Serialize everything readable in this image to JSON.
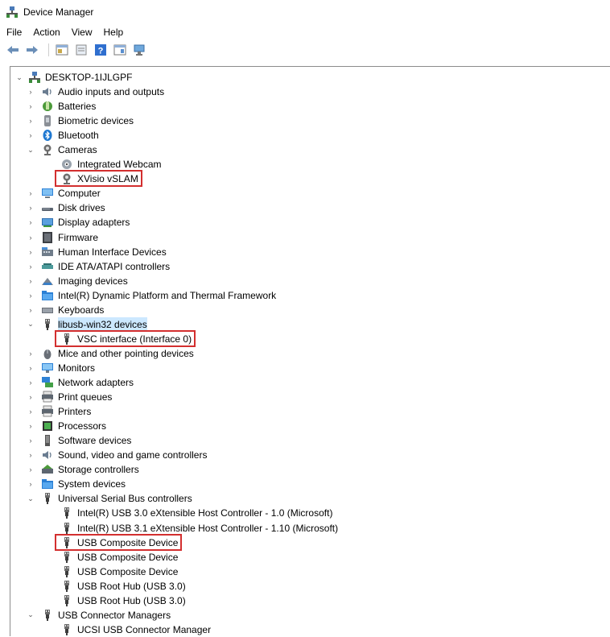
{
  "window": {
    "title": "Device Manager"
  },
  "menu": [
    "File",
    "Action",
    "View",
    "Help"
  ],
  "toolbar": [
    "back-icon",
    "forward-icon",
    "properties-icon",
    "show-hidden-icon",
    "help-icon",
    "update-driver-icon",
    "scan-hardware-icon"
  ],
  "colors": {
    "highlight_box": "#d32f2f",
    "selection": "#cce8ff"
  },
  "tree": {
    "root": "DESKTOP-1IJLGPF",
    "items": [
      {
        "label": "Audio inputs and outputs",
        "icon": "speaker-icon",
        "level": 1,
        "expander": "collapsed"
      },
      {
        "label": "Batteries",
        "icon": "battery-icon",
        "level": 1,
        "expander": "collapsed"
      },
      {
        "label": "Biometric devices",
        "icon": "biometric-icon",
        "level": 1,
        "expander": "collapsed"
      },
      {
        "label": "Bluetooth",
        "icon": "bluetooth-icon",
        "level": 1,
        "expander": "collapsed"
      },
      {
        "label": "Cameras",
        "icon": "camera-icon",
        "level": 1,
        "expander": "expanded"
      },
      {
        "label": "Integrated Webcam",
        "icon": "webcam-icon",
        "level": 2,
        "expander": "none"
      },
      {
        "label": "XVisio vSLAM",
        "icon": "camera-icon",
        "level": 2,
        "expander": "none",
        "highlight": true
      },
      {
        "label": "Computer",
        "icon": "computer-icon",
        "level": 1,
        "expander": "collapsed"
      },
      {
        "label": "Disk drives",
        "icon": "disk-icon",
        "level": 1,
        "expander": "collapsed"
      },
      {
        "label": "Display adapters",
        "icon": "display-adapter-icon",
        "level": 1,
        "expander": "collapsed"
      },
      {
        "label": "Firmware",
        "icon": "firmware-icon",
        "level": 1,
        "expander": "collapsed"
      },
      {
        "label": "Human Interface Devices",
        "icon": "hid-icon",
        "level": 1,
        "expander": "collapsed"
      },
      {
        "label": "IDE ATA/ATAPI controllers",
        "icon": "ide-icon",
        "level": 1,
        "expander": "collapsed"
      },
      {
        "label": "Imaging devices",
        "icon": "imaging-icon",
        "level": 1,
        "expander": "collapsed"
      },
      {
        "label": "Intel(R) Dynamic Platform and Thermal Framework",
        "icon": "folder-icon",
        "level": 1,
        "expander": "collapsed"
      },
      {
        "label": "Keyboards",
        "icon": "keyboard-icon",
        "level": 1,
        "expander": "collapsed"
      },
      {
        "label": "libusb-win32 devices",
        "icon": "usb-plug-icon",
        "level": 1,
        "expander": "expanded",
        "selected": true
      },
      {
        "label": "VSC interface (Interface 0)",
        "icon": "usb-plug-icon",
        "level": 2,
        "expander": "none",
        "highlight": true
      },
      {
        "label": "Mice and other pointing devices",
        "icon": "mouse-icon",
        "level": 1,
        "expander": "collapsed"
      },
      {
        "label": "Monitors",
        "icon": "monitor-icon",
        "level": 1,
        "expander": "collapsed"
      },
      {
        "label": "Network adapters",
        "icon": "network-icon",
        "level": 1,
        "expander": "collapsed"
      },
      {
        "label": "Print queues",
        "icon": "printer-icon",
        "level": 1,
        "expander": "collapsed"
      },
      {
        "label": "Printers",
        "icon": "printer-icon",
        "level": 1,
        "expander": "collapsed"
      },
      {
        "label": "Processors",
        "icon": "processor-icon",
        "level": 1,
        "expander": "collapsed"
      },
      {
        "label": "Software devices",
        "icon": "software-device-icon",
        "level": 1,
        "expander": "collapsed"
      },
      {
        "label": "Sound, video and game controllers",
        "icon": "speaker-icon",
        "level": 1,
        "expander": "collapsed"
      },
      {
        "label": "Storage controllers",
        "icon": "storage-icon",
        "level": 1,
        "expander": "collapsed"
      },
      {
        "label": "System devices",
        "icon": "folder-icon",
        "level": 1,
        "expander": "collapsed"
      },
      {
        "label": "Universal Serial Bus controllers",
        "icon": "usb-plug-icon",
        "level": 1,
        "expander": "expanded"
      },
      {
        "label": "Intel(R) USB 3.0 eXtensible Host Controller - 1.0 (Microsoft)",
        "icon": "usb-plug-icon",
        "level": 2,
        "expander": "none"
      },
      {
        "label": "Intel(R) USB 3.1 eXtensible Host Controller - 1.10 (Microsoft)",
        "icon": "usb-plug-icon",
        "level": 2,
        "expander": "none"
      },
      {
        "label": "USB Composite Device",
        "icon": "usb-plug-icon",
        "level": 2,
        "expander": "none",
        "highlight": true
      },
      {
        "label": "USB Composite Device",
        "icon": "usb-plug-icon",
        "level": 2,
        "expander": "none"
      },
      {
        "label": "USB Composite Device",
        "icon": "usb-plug-icon",
        "level": 2,
        "expander": "none"
      },
      {
        "label": "USB Root Hub (USB 3.0)",
        "icon": "usb-plug-icon",
        "level": 2,
        "expander": "none"
      },
      {
        "label": "USB Root Hub (USB 3.0)",
        "icon": "usb-plug-icon",
        "level": 2,
        "expander": "none"
      },
      {
        "label": "USB Connector Managers",
        "icon": "usb-plug-icon",
        "level": 1,
        "expander": "expanded"
      },
      {
        "label": "UCSI USB Connector Manager",
        "icon": "usb-plug-icon",
        "level": 2,
        "expander": "none"
      }
    ]
  }
}
